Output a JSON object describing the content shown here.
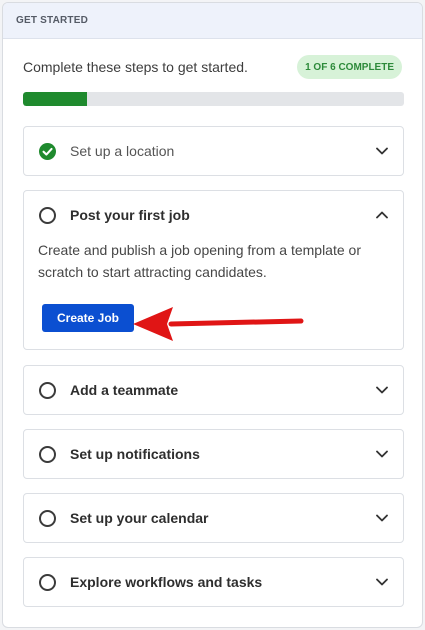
{
  "header": {
    "title": "GET STARTED"
  },
  "intro": {
    "text": "Complete these steps to get started.",
    "badge": "1 OF 6 COMPLETE"
  },
  "progress": {
    "completed": 1,
    "total": 6,
    "fraction": 0.1667,
    "color": "#1f8a2e"
  },
  "steps": [
    {
      "label": "Set up a location",
      "status": "complete",
      "icon": "check-circle-icon"
    },
    {
      "label": "Post your first job",
      "status": "expanded",
      "icon": "empty-circle-icon",
      "description": "Create and publish a job opening from a template or scratch to start attracting candidates.",
      "action_label": "Create Job"
    },
    {
      "label": "Add a teammate",
      "status": "incomplete",
      "icon": "empty-circle-icon"
    },
    {
      "label": "Set up notifications",
      "status": "incomplete",
      "icon": "empty-circle-icon"
    },
    {
      "label": "Set up your calendar",
      "status": "incomplete",
      "icon": "empty-circle-icon"
    },
    {
      "label": "Explore workflows and tasks",
      "status": "incomplete",
      "icon": "empty-circle-icon"
    }
  ],
  "colors": {
    "accent": "#0b4fd1",
    "success": "#1f8a2e",
    "badge_bg": "#d7f2d8",
    "annotation_arrow": "#e01515"
  }
}
